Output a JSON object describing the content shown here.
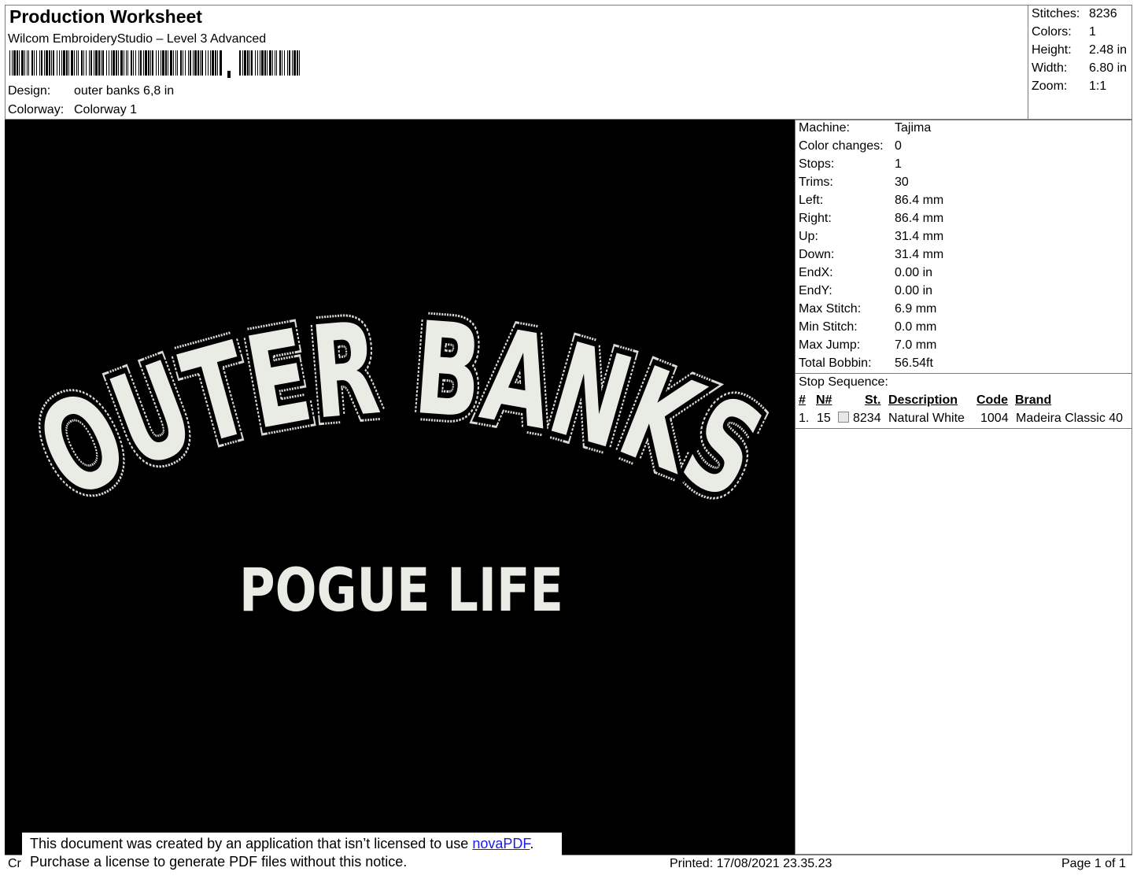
{
  "header": {
    "title": "Production Worksheet",
    "subtitle": "Wilcom EmbroideryStudio – Level 3 Advanced",
    "design_label": "Design:",
    "design_value": "outer banks  6,8 in",
    "colorway_label": "Colorway:",
    "colorway_value": "Colorway 1"
  },
  "summary": [
    {
      "label": "Stitches:",
      "value": "8236"
    },
    {
      "label": "Colors:",
      "value": "1"
    },
    {
      "label": "Height:",
      "value": "2.48 in"
    },
    {
      "label": "Width:",
      "value": "6.80 in"
    },
    {
      "label": "Zoom:",
      "value": "1:1"
    }
  ],
  "design": {
    "line1": "OUTER BANKS",
    "line2": "POGUE LIFE",
    "background": "#000000",
    "thread_color": "#e9ece4"
  },
  "info": [
    {
      "label": "Machine:",
      "value": "Tajima"
    },
    {
      "label": "Color changes:",
      "value": "0"
    },
    {
      "label": "Stops:",
      "value": "1"
    },
    {
      "label": "Trims:",
      "value": "30"
    },
    {
      "label": "Left:",
      "value": "86.4 mm"
    },
    {
      "label": "Right:",
      "value": "86.4 mm"
    },
    {
      "label": "Up:",
      "value": "31.4 mm"
    },
    {
      "label": "Down:",
      "value": "31.4 mm"
    },
    {
      "label": "EndX:",
      "value": "0.00 in"
    },
    {
      "label": "EndY:",
      "value": "0.00 in"
    },
    {
      "label": "Max Stitch:",
      "value": "6.9 mm"
    },
    {
      "label": "Min Stitch:",
      "value": "0.0 mm"
    },
    {
      "label": "Max Jump:",
      "value": "7.0 mm"
    },
    {
      "label": "Total Bobbin:",
      "value": "56.54ft"
    }
  ],
  "stop_sequence": {
    "title": "Stop Sequence:",
    "headers": {
      "num": "#",
      "needle": "N#",
      "stitches": "St.",
      "description": "Description",
      "code": "Code",
      "brand": "Brand"
    },
    "rows": [
      {
        "num": "1.",
        "needle": "15",
        "stitches": "8234",
        "description": "Natural White",
        "code": "1004",
        "brand": "Madeira Classic 40"
      }
    ]
  },
  "footer": {
    "created": "Cr",
    "printed": "Printed: 17/08/2021 23.35.23",
    "page": "Page 1 of 1"
  },
  "notice": {
    "line1_prefix": "This document was created by an application that isn’t licensed to use ",
    "link_text": "novaPDF",
    "line1_suffix": ".",
    "line2": "Purchase a license to generate PDF files without this notice."
  }
}
